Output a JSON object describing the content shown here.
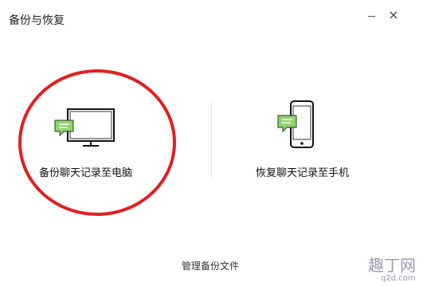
{
  "window": {
    "title": "备份与恢复",
    "minimize_icon": "minimize-icon",
    "close_icon": "close-icon"
  },
  "options": {
    "backup": {
      "label": "备份聊天记录至电脑",
      "icon": "monitor-message-icon"
    },
    "restore": {
      "label": "恢复聊天记录至手机",
      "icon": "phone-message-icon"
    }
  },
  "footer": {
    "manage_label": "管理备份文件"
  },
  "watermark": {
    "main": "趣丁网",
    "sub": "q2d.com"
  },
  "colors": {
    "highlight_circle": "#e21f1f",
    "chat_bubble": "#8ed66a",
    "icon_outline": "#111111"
  }
}
